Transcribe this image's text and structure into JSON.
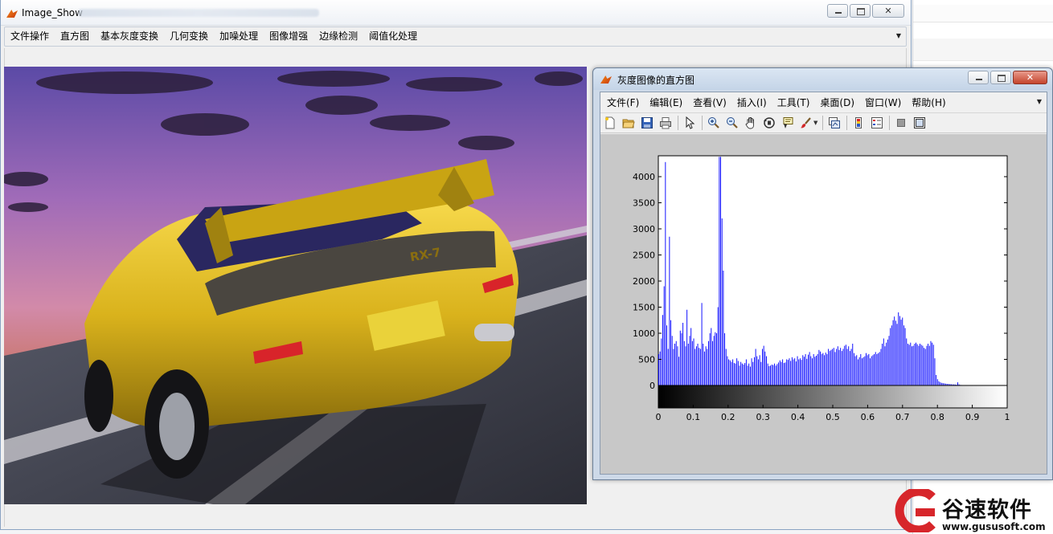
{
  "main_window": {
    "title": "Image_Show",
    "menu": [
      "文件操作",
      "直方图",
      "基本灰度变换",
      "几何变换",
      "加噪处理",
      "图像增强",
      "边缘检测",
      "阈值化处理"
    ]
  },
  "figure_window": {
    "title": "灰度图像的直方图",
    "menu": [
      "文件(F)",
      "编辑(E)",
      "查看(V)",
      "插入(I)",
      "工具(T)",
      "桌面(D)",
      "窗口(W)",
      "帮助(H)"
    ],
    "toolbar": [
      "new-figure-icon",
      "open-icon",
      "save-icon",
      "print-icon",
      "pointer-icon",
      "zoom-in-icon",
      "zoom-out-icon",
      "pan-icon",
      "rotate-3d-icon",
      "data-cursor-icon",
      "brush-icon",
      "link-plot-icon",
      "colorbar-icon",
      "legend-icon",
      "hide-plot-tools-icon",
      "show-plot-tools-icon"
    ]
  },
  "photo": {
    "badge_text": "RX-7"
  },
  "chart_data": {
    "type": "bar",
    "xlim": [
      0,
      1
    ],
    "ylim": [
      0,
      4400
    ],
    "xticks": [
      "0",
      "0.1",
      "0.2",
      "0.3",
      "0.4",
      "0.5",
      "0.6",
      "0.7",
      "0.8",
      "0.9",
      "1"
    ],
    "yticks": [
      "0",
      "500",
      "1000",
      "1500",
      "2000",
      "2500",
      "3000",
      "3500",
      "4000"
    ],
    "bar_color": "#0000ff",
    "colorbar": "grayscale",
    "grid": false,
    "bins": 256,
    "values": [
      600,
      650,
      900,
      1350,
      1900,
      4280,
      1150,
      700,
      2850,
      1250,
      950,
      700,
      800,
      850,
      750,
      550,
      1050,
      1000,
      1200,
      850,
      750,
      1450,
      800,
      950,
      1100,
      850,
      900,
      700,
      750,
      800,
      720,
      700,
      1580,
      800,
      650,
      750,
      700,
      850,
      1000,
      1100,
      850,
      950,
      1020,
      1000,
      1500,
      4380,
      4380,
      3200,
      2200,
      1000,
      700,
      560,
      500,
      480,
      450,
      500,
      430,
      420,
      520,
      470,
      380,
      450,
      420,
      400,
      430,
      500,
      380,
      420,
      360,
      520,
      450,
      540,
      700,
      560,
      500,
      580,
      450,
      700,
      760,
      650,
      560,
      420,
      370,
      380,
      400,
      390,
      420,
      380,
      410,
      440,
      480,
      450,
      500,
      430,
      440,
      500,
      490,
      520,
      470,
      540,
      500,
      520,
      460,
      560,
      500,
      520,
      490,
      580,
      550,
      600,
      510,
      590,
      640,
      560,
      520,
      600,
      550,
      570,
      600,
      680,
      650,
      600,
      620,
      580,
      630,
      600,
      700,
      660,
      680,
      700,
      720,
      640,
      700,
      750,
      680,
      720,
      660,
      700,
      760,
      780,
      700,
      750,
      660,
      700,
      800,
      620,
      560,
      580,
      500,
      540,
      600,
      520,
      540,
      560,
      620,
      580,
      600,
      520,
      560,
      580,
      600,
      640,
      600,
      620,
      640,
      700,
      800,
      900,
      750,
      820,
      880,
      950,
      1100,
      1150,
      1250,
      1320,
      1240,
      1180,
      1400,
      1330,
      1260,
      1300,
      1150,
      1100,
      900,
      800,
      780,
      820,
      750,
      760,
      800,
      820,
      790,
      760,
      800,
      780,
      760,
      720,
      700,
      760,
      800,
      760,
      850,
      820,
      780,
      520,
      200,
      120,
      80,
      60,
      50,
      45,
      40,
      35,
      30,
      30,
      25,
      25,
      20,
      20,
      18,
      15,
      60,
      20,
      10,
      8,
      5,
      3,
      2,
      1,
      0,
      0,
      0,
      0,
      0,
      0,
      0,
      0,
      0,
      0,
      0,
      0,
      0,
      0,
      0,
      0,
      0,
      0,
      0,
      0,
      0,
      0,
      0,
      0,
      0,
      0,
      0,
      0,
      0
    ]
  },
  "watermark": {
    "name": "谷速软件",
    "url": "www.gususoft.com"
  }
}
